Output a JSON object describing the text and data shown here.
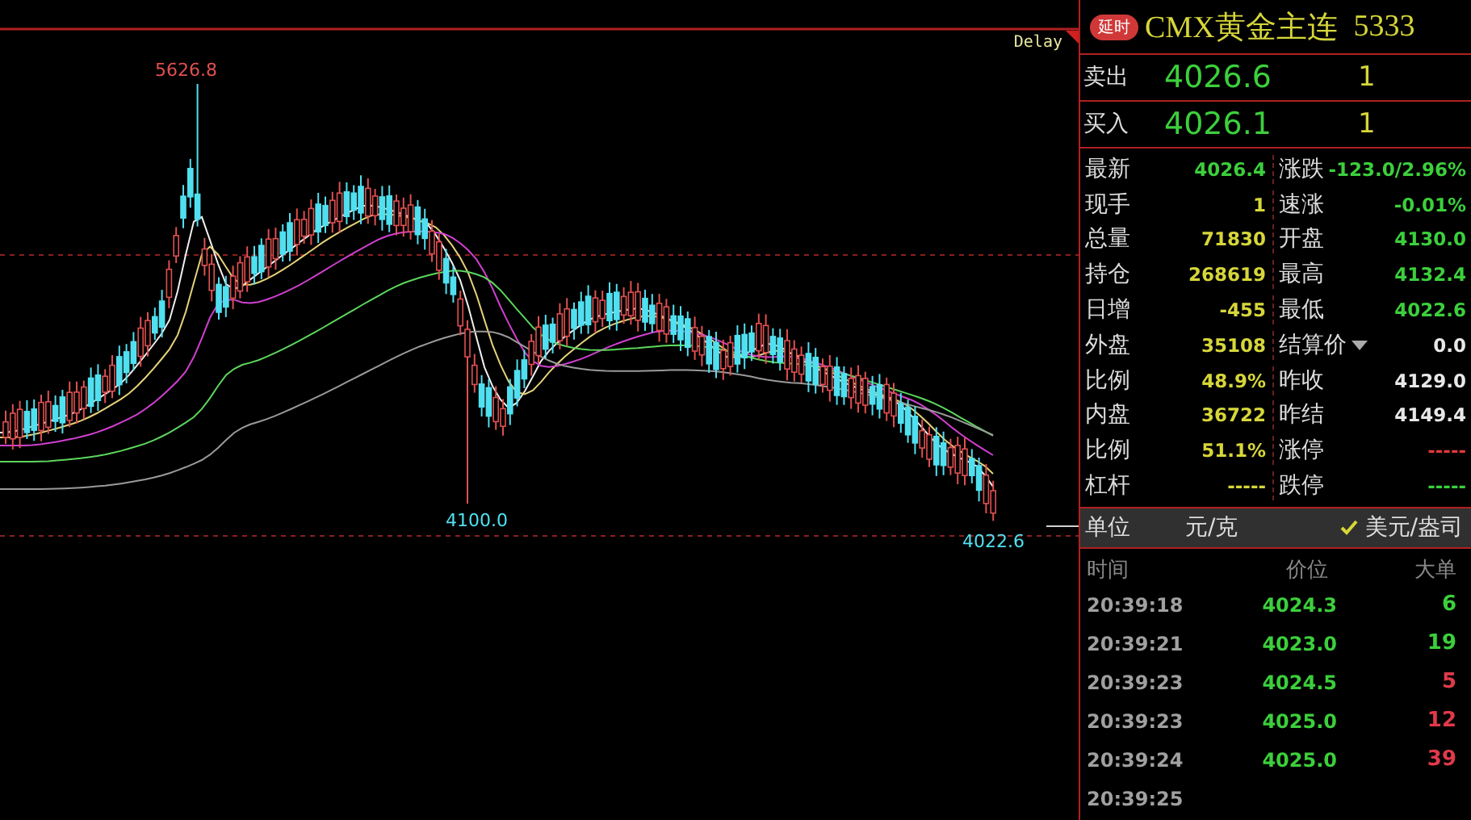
{
  "chart": {
    "delay_label": "Delay",
    "high_label": "5626.8",
    "low_label": "4100.0",
    "last_label": "4022.6"
  },
  "quote": {
    "badge": "延时",
    "name": "CMX黄金主连",
    "code": "5333"
  },
  "bid_ask": [
    {
      "label": "卖出",
      "price": "4026.6",
      "volume": "1"
    },
    {
      "label": "买入",
      "price": "4026.1",
      "volume": "1"
    }
  ],
  "stats": [
    {
      "left": {
        "label": "最新",
        "value": "4026.4",
        "color": "#3ccf3c"
      },
      "right": {
        "label": "涨跌",
        "value": "-123.0/2.96%",
        "color": "#3ccf3c"
      }
    },
    {
      "left": {
        "label": "现手",
        "value": "1",
        "color": "#d6d63a"
      },
      "right": {
        "label": "速涨",
        "value": "-0.01%",
        "color": "#3ccf3c"
      }
    },
    {
      "left": {
        "label": "总量",
        "value": "71830",
        "color": "#d6d63a"
      },
      "right": {
        "label": "开盘",
        "value": "4130.0",
        "color": "#3ccf3c"
      }
    },
    {
      "left": {
        "label": "持仓",
        "value": "268619",
        "color": "#d6d63a"
      },
      "right": {
        "label": "最高",
        "value": "4132.4",
        "color": "#3ccf3c"
      }
    },
    {
      "left": {
        "label": "日增",
        "value": "-455",
        "color": "#d6d63a"
      },
      "right": {
        "label": "最低",
        "value": "4022.6",
        "color": "#3ccf3c"
      }
    },
    {
      "left": {
        "label": "外盘",
        "value": "35108",
        "color": "#d6d63a"
      },
      "right": {
        "label": "结算价",
        "value": "0.0",
        "color": "#e8e8e8",
        "dropdown": true
      }
    },
    {
      "left": {
        "label": "比例",
        "value": "48.9%",
        "color": "#d6d63a"
      },
      "right": {
        "label": "昨收",
        "value": "4129.0",
        "color": "#e8e8e8"
      }
    },
    {
      "left": {
        "label": "内盘",
        "value": "36722",
        "color": "#d6d63a"
      },
      "right": {
        "label": "昨结",
        "value": "4149.4",
        "color": "#e8e8e8"
      }
    },
    {
      "left": {
        "label": "比例",
        "value": "51.1%",
        "color": "#d6d63a"
      },
      "right": {
        "label": "涨停",
        "value": "-----",
        "color": "#e03a3a"
      }
    },
    {
      "left": {
        "label": "杠杆",
        "value": "-----",
        "color": "#d6d63a"
      },
      "right": {
        "label": "跌停",
        "value": "-----",
        "color": "#3ccf3c"
      }
    }
  ],
  "units": {
    "label": "单位",
    "options": [
      {
        "label": "元/克",
        "selected": false
      },
      {
        "label": "美元/盎司",
        "selected": true
      }
    ]
  },
  "trades": {
    "columns": [
      "时间",
      "价位",
      "大单"
    ],
    "rows": [
      {
        "time": "20:39:18",
        "price": "4024.3",
        "volume": "6",
        "color": "#3ccf3c"
      },
      {
        "time": "20:39:21",
        "price": "4023.0",
        "volume": "19",
        "color": "#3ccf3c"
      },
      {
        "time": "20:39:23",
        "price": "4024.5",
        "volume": "5",
        "color": "#e03a4a"
      },
      {
        "time": "20:39:23",
        "price": "4025.0",
        "volume": "12",
        "color": "#e03a4a"
      },
      {
        "time": "20:39:24",
        "price": "4025.0",
        "volume": "39",
        "color": "#e03a4a"
      },
      {
        "time": "20:39:25"
      }
    ]
  }
}
